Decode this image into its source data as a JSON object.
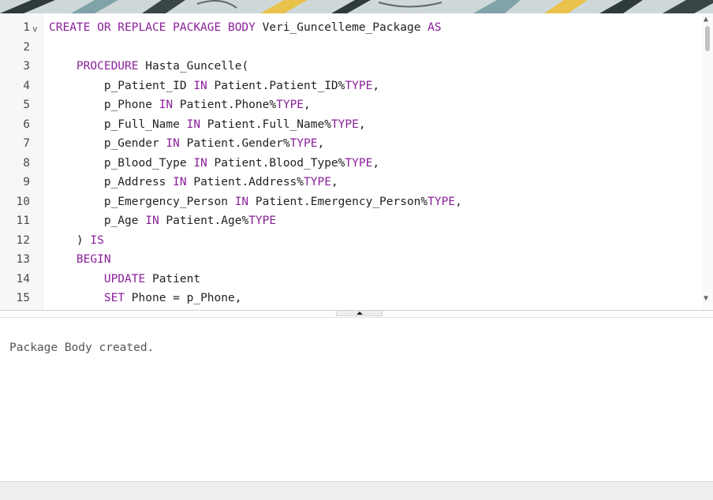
{
  "editor": {
    "lines": [
      {
        "n": "1",
        "code": [
          {
            "t": "CREATE OR REPLACE PACKAGE BODY",
            "k": 1
          },
          {
            "t": " Veri_Guncelleme_Package "
          },
          {
            "t": "AS",
            "k": 1
          }
        ]
      },
      {
        "n": "2",
        "code": []
      },
      {
        "n": "3",
        "code": [
          {
            "t": "    "
          },
          {
            "t": "PROCEDURE",
            "k": 1
          },
          {
            "t": " Hasta_Guncelle("
          }
        ]
      },
      {
        "n": "4",
        "code": [
          {
            "t": "        p_Patient_ID "
          },
          {
            "t": "IN",
            "k": 1
          },
          {
            "t": " Patient.Patient_ID%"
          },
          {
            "t": "TYPE",
            "k": 1
          },
          {
            "t": ","
          }
        ]
      },
      {
        "n": "5",
        "code": [
          {
            "t": "        p_Phone "
          },
          {
            "t": "IN",
            "k": 1
          },
          {
            "t": " Patient.Phone%"
          },
          {
            "t": "TYPE",
            "k": 1
          },
          {
            "t": ","
          }
        ]
      },
      {
        "n": "6",
        "code": [
          {
            "t": "        p_Full_Name "
          },
          {
            "t": "IN",
            "k": 1
          },
          {
            "t": " Patient.Full_Name%"
          },
          {
            "t": "TYPE",
            "k": 1
          },
          {
            "t": ","
          }
        ]
      },
      {
        "n": "7",
        "code": [
          {
            "t": "        p_Gender "
          },
          {
            "t": "IN",
            "k": 1
          },
          {
            "t": " Patient.Gender%"
          },
          {
            "t": "TYPE",
            "k": 1
          },
          {
            "t": ","
          }
        ]
      },
      {
        "n": "8",
        "code": [
          {
            "t": "        p_Blood_Type "
          },
          {
            "t": "IN",
            "k": 1
          },
          {
            "t": " Patient.Blood_Type%"
          },
          {
            "t": "TYPE",
            "k": 1
          },
          {
            "t": ","
          }
        ]
      },
      {
        "n": "9",
        "code": [
          {
            "t": "        p_Address "
          },
          {
            "t": "IN",
            "k": 1
          },
          {
            "t": " Patient.Address%"
          },
          {
            "t": "TYPE",
            "k": 1
          },
          {
            "t": ","
          }
        ]
      },
      {
        "n": "10",
        "code": [
          {
            "t": "        p_Emergency_Person "
          },
          {
            "t": "IN",
            "k": 1
          },
          {
            "t": " Patient.Emergency_Person%"
          },
          {
            "t": "TYPE",
            "k": 1
          },
          {
            "t": ","
          }
        ]
      },
      {
        "n": "11",
        "code": [
          {
            "t": "        p_Age "
          },
          {
            "t": "IN",
            "k": 1
          },
          {
            "t": " Patient.Age%"
          },
          {
            "t": "TYPE",
            "k": 1
          }
        ]
      },
      {
        "n": "12",
        "code": [
          {
            "t": "    ) "
          },
          {
            "t": "IS",
            "k": 1
          }
        ]
      },
      {
        "n": "13",
        "code": [
          {
            "t": "    "
          },
          {
            "t": "BEGIN",
            "k": 1
          }
        ]
      },
      {
        "n": "14",
        "code": [
          {
            "t": "        "
          },
          {
            "t": "UPDATE",
            "k": 1
          },
          {
            "t": " Patient"
          }
        ]
      },
      {
        "n": "15",
        "code": [
          {
            "t": "        "
          },
          {
            "t": "SET",
            "k": 1
          },
          {
            "t": " Phone = p_Phone,"
          }
        ]
      }
    ]
  },
  "output": {
    "message": "Package Body created."
  },
  "colors": {
    "keyword": "#8a1f9a",
    "text": "#222222",
    "line_number": "#4a4a4a",
    "gutter": "#f7f7f7"
  },
  "icons": {
    "fold": "chevron-down-icon",
    "scroll_up": "chevron-up-icon",
    "scroll_down": "chevron-down-icon",
    "splitter": "caret-up-icon"
  }
}
